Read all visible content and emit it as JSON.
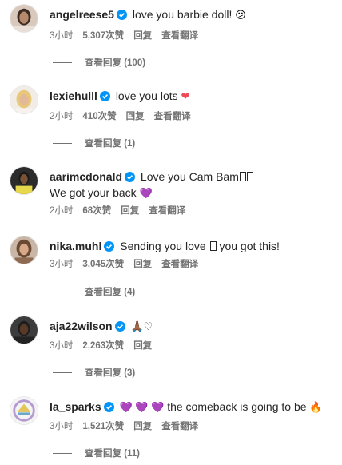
{
  "labels": {
    "like_unit": "次赞",
    "reply": "回复",
    "translate": "查看翻译",
    "view_replies": "查看回复"
  },
  "comments": [
    {
      "user": "angelreese5",
      "text": "love you barbie doll!",
      "emoji": "😕",
      "time": "3小时",
      "likes": "5,307次赞",
      "reply": "回复",
      "translate": "查看翻译",
      "replies": "查看回复 (100)"
    },
    {
      "user": "lexiehulll",
      "text": "love you lots",
      "emoji": "❤",
      "time": "2小时",
      "likes": "410次赞",
      "reply": "回复",
      "translate": "查看翻译",
      "replies": "查看回复 (1)"
    },
    {
      "user": "aarimcdonald",
      "text": "Love you Cam Bam",
      "text2": "We got your back",
      "emoji2": "💜",
      "time": "2小时",
      "likes": "68次赞",
      "reply": "回复",
      "translate": "查看翻译"
    },
    {
      "user": "nika.muhl",
      "text": "Sending you love",
      "text_after": "you got this!",
      "time": "3小时",
      "likes": "3,045次赞",
      "reply": "回复",
      "translate": "查看翻译",
      "replies": "查看回复 (4)"
    },
    {
      "user": "aja22wilson",
      "emoji": "🙏🏾",
      "emoji_b": "♡",
      "time": "3小时",
      "likes": "2,263次赞",
      "reply": "回复",
      "replies": "查看回复 (3)"
    },
    {
      "user": "la_sparks",
      "hearts": "💜 💜 💜",
      "text": "the comeback is going to be",
      "emoji": "🔥",
      "time": "3小时",
      "likes": "1,521次赞",
      "reply": "回复",
      "translate": "查看翻译",
      "replies": "查看回复 (11)"
    }
  ],
  "colors": {
    "verified": "#0095f6",
    "meta": "#737373",
    "username": "#262626"
  }
}
